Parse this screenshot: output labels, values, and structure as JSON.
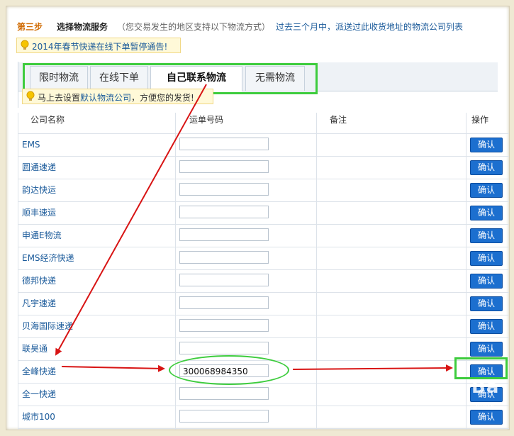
{
  "header": {
    "step": "第三步",
    "title": "选择物流服务",
    "description": "（您交易发生的地区支持以下物流方式）",
    "history_link": "过去三个月中，派送过此收货地址的物流公司列表"
  },
  "notice1": {
    "text": "2014年春节快递在线下单暂停通告!"
  },
  "notice2": {
    "prefix": "马上去设置",
    "link": "默认物流公司",
    "suffix": "，方便您的发货!"
  },
  "tabs": [
    {
      "label": "限时物流",
      "active": false
    },
    {
      "label": "在线下单",
      "active": false
    },
    {
      "label": "自己联系物流",
      "active": true
    },
    {
      "label": "无需物流",
      "active": false
    }
  ],
  "table": {
    "headers": {
      "company": "公司名称",
      "tracking": "运单号码",
      "note": "备注",
      "action": "操作"
    },
    "confirm_label": "确认",
    "rows": [
      {
        "company": "EMS",
        "tracking": ""
      },
      {
        "company": "圆通速递",
        "tracking": ""
      },
      {
        "company": "韵达快运",
        "tracking": ""
      },
      {
        "company": "顺丰速运",
        "tracking": ""
      },
      {
        "company": "申通E物流",
        "tracking": ""
      },
      {
        "company": "EMS经济快递",
        "tracking": ""
      },
      {
        "company": "德邦快递",
        "tracking": ""
      },
      {
        "company": "凡宇速递",
        "tracking": ""
      },
      {
        "company": "贝海国际速递",
        "tracking": ""
      },
      {
        "company": "联昊通",
        "tracking": ""
      },
      {
        "company": "全峰快递",
        "tracking": "300068984350"
      },
      {
        "company": "全一快递",
        "tracking": ""
      },
      {
        "company": "城市100",
        "tracking": ""
      }
    ]
  },
  "watermark": {
    "main": "Ba",
    "sub": "jingy"
  },
  "colors": {
    "accent_green": "#3dcc3d",
    "arrow_red": "#d81414",
    "button_blue": "#1c6fcf",
    "link_blue": "#1a5a9a"
  }
}
